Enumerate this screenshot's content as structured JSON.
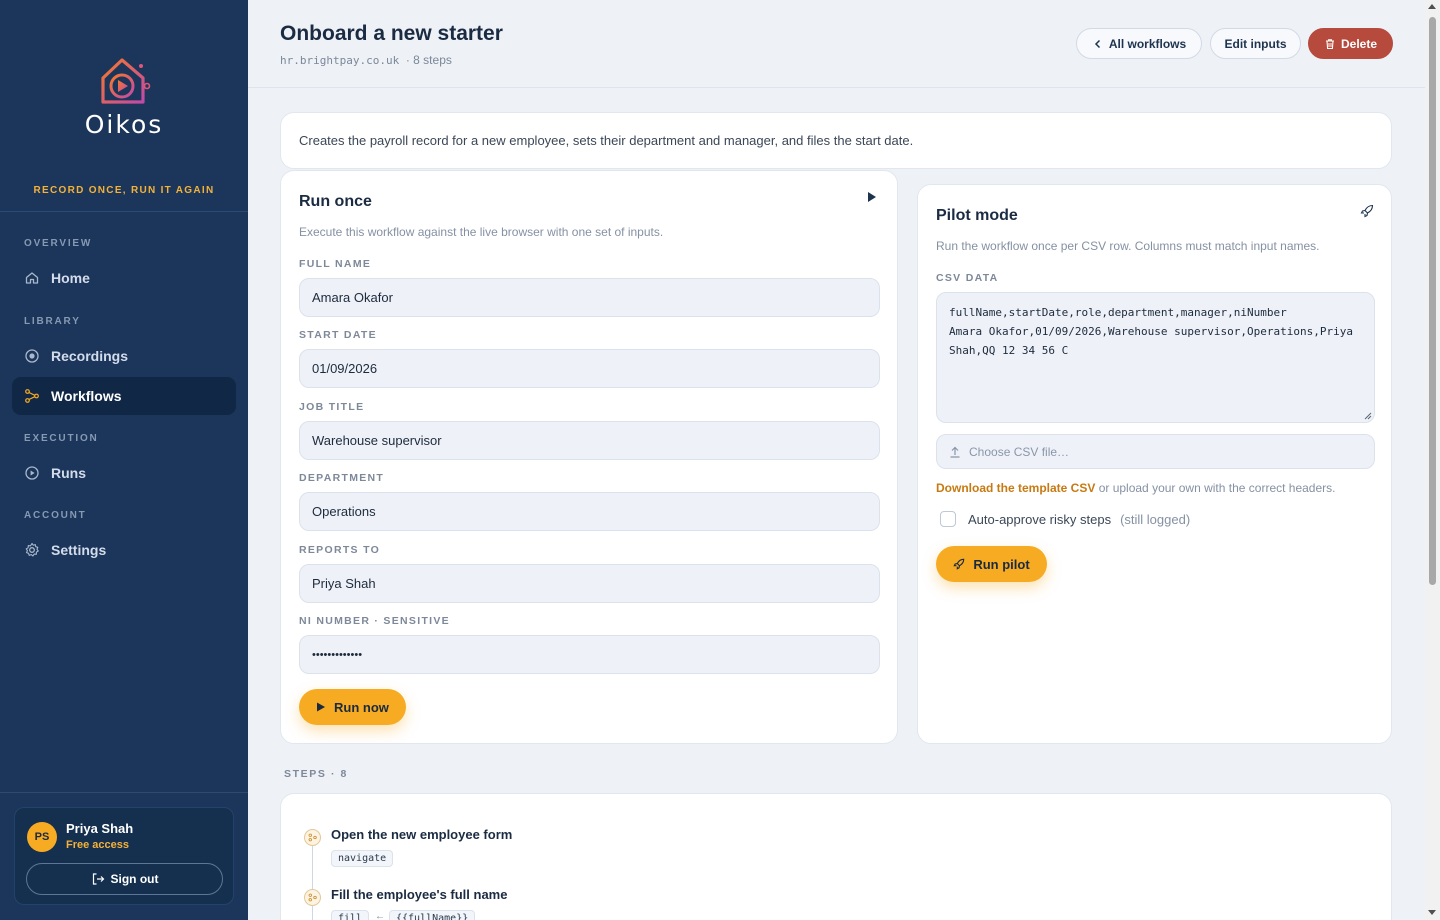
{
  "brand": {
    "name": "Oikos",
    "tagline": "RECORD ONCE, RUN IT AGAIN"
  },
  "sidebar": {
    "sections": [
      "OVERVIEW",
      "LIBRARY",
      "EXECUTION",
      "ACCOUNT"
    ],
    "items": [
      {
        "label": "Home",
        "icon": "home-icon"
      },
      {
        "label": "Recordings",
        "icon": "record-icon"
      },
      {
        "label": "Workflows",
        "icon": "workflow-icon",
        "active": true
      },
      {
        "label": "Runs",
        "icon": "play-circle-icon"
      },
      {
        "label": "Settings",
        "icon": "gear-icon"
      }
    ],
    "user": {
      "initials": "PS",
      "name": "Priya Shah",
      "plan": "Free access",
      "signout": "Sign out"
    }
  },
  "header": {
    "title": "Onboard a new starter",
    "domain": "hr.brightpay.co.uk",
    "steps": "· 8 steps",
    "all_workflows": "All workflows",
    "edit_inputs": "Edit inputs",
    "delete": "Delete"
  },
  "description": "Creates the payroll record for a new employee, sets their department and manager, and files the start date.",
  "run_once": {
    "title": "Run once",
    "help": "Execute this workflow against the live browser with one set of inputs.",
    "fields": [
      {
        "label": "FULL NAME",
        "value": "Amara Okafor"
      },
      {
        "label": "START DATE",
        "value": "01/09/2026"
      },
      {
        "label": "JOB TITLE",
        "value": "Warehouse supervisor"
      },
      {
        "label": "DEPARTMENT",
        "value": "Operations"
      },
      {
        "label": "REPORTS TO",
        "value": "Priya Shah"
      },
      {
        "label": "NI NUMBER · SENSITIVE",
        "value": "•••••••••••••"
      }
    ],
    "run_button": "Run now"
  },
  "pilot": {
    "title": "Pilot mode",
    "help": "Run the workflow once per CSV row. Columns must match input names.",
    "csv_label": "CSV DATA",
    "csv_text": "fullName,startDate,role,department,manager,niNumber\nAmara Okafor,01/09/2026,Warehouse supervisor,Operations,Priya Shah,QQ 12 34 56 C",
    "file_placeholder": "Choose CSV file…",
    "template_link": "Download the template CSV",
    "template_rest": " or upload your own with the correct headers.",
    "auto_approve": "Auto-approve risky steps",
    "auto_approve_note": "(still logged)",
    "run_button": "Run pilot"
  },
  "steps": {
    "label": "STEPS · 8",
    "items": [
      {
        "title": "Open the new employee form",
        "action": "navigate"
      },
      {
        "title": "Fill the employee's full name",
        "action": "fill",
        "arrow": "←",
        "value": "{{fullName}}"
      }
    ]
  },
  "colors": {
    "sidebar_bg": "#1b365a",
    "accent": "#f6ab23",
    "danger": "#b64a3d",
    "link": "#c77a12"
  }
}
